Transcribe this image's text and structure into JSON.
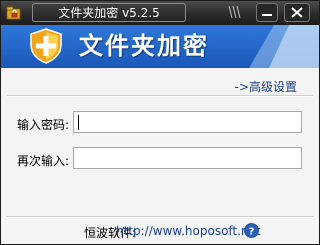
{
  "window": {
    "title": "文件夹加密 v5.2.5",
    "title_slashes": "\\\\\\"
  },
  "banner": {
    "title": "文件夹加密",
    "icon": "shield-icon"
  },
  "advanced_link": "->高级设置",
  "form": {
    "password_label": "输入密码:",
    "password_value": "",
    "confirm_label": "再次输入:",
    "confirm_value": ""
  },
  "footer": {
    "label": "恒波软件:",
    "url": "http://www.hoposoft.net",
    "help_icon": "question-icon"
  },
  "colors": {
    "banner_blue": "#1f63c6",
    "title_bar": "#2a2a2a",
    "link": "#1a3f8c"
  }
}
